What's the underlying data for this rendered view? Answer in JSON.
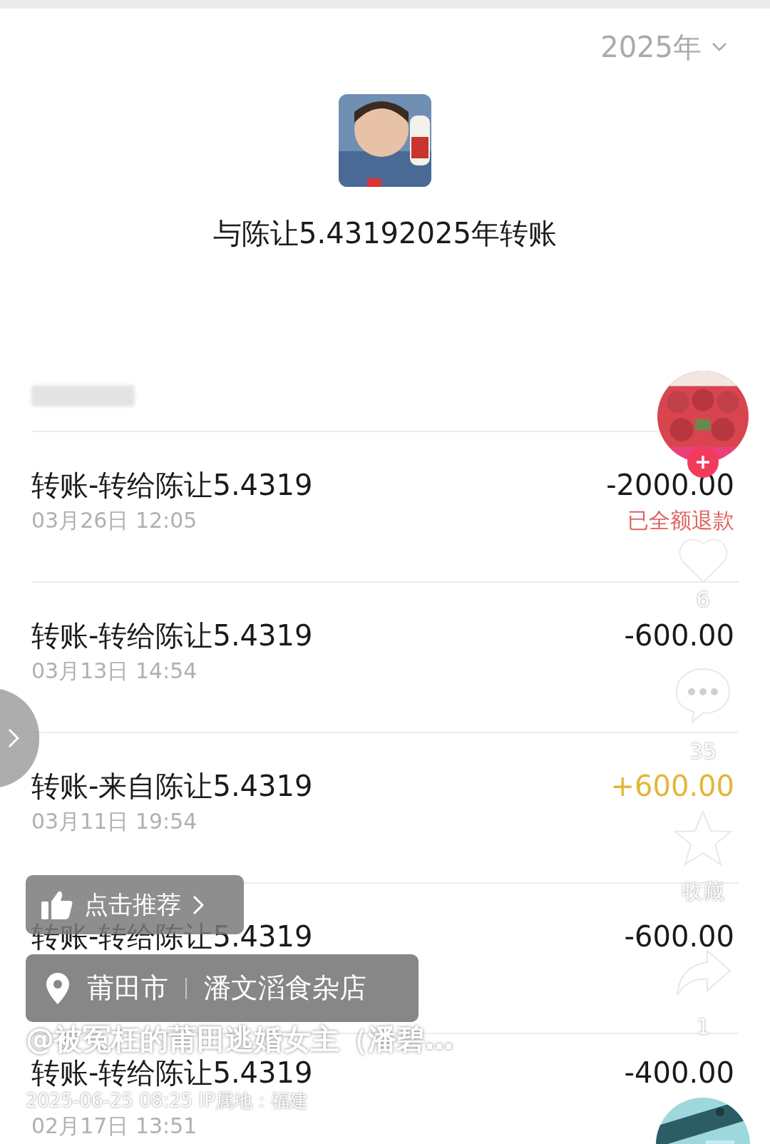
{
  "header": {
    "year": "2025年"
  },
  "title": "与陈让5.43192025年转账",
  "transactions": [
    {
      "title": "转账-转给陈让5.4319",
      "date": "03月26日 12:05",
      "amount": "-2000.00",
      "color": "#1a1a1a",
      "note": "已全额退款"
    },
    {
      "title": "转账-转给陈让5.4319",
      "date": "03月13日 14:54",
      "amount": "-600.00",
      "color": "#1a1a1a"
    },
    {
      "title": "转账-来自陈让5.4319",
      "date": "03月11日 19:54",
      "amount": "+600.00",
      "color": "#e3b63c"
    },
    {
      "title": "转账-转给陈让5.4319",
      "amount": "-600.00",
      "color": "#1a1a1a"
    },
    {
      "title": "转账-转给陈让5.4319",
      "date": "02月17日 13:51",
      "amount": "-400.00",
      "color": "#1a1a1a"
    }
  ],
  "video_overlay": {
    "recommend": "点击推荐",
    "location": {
      "city": "莆田市",
      "place": "潘文滔食杂店"
    },
    "author": "@被冤枉的莆田逃婚女主（潘碧…",
    "timestamp": "2025-06-25 08:25 IP属地：福建",
    "likes": "6",
    "comments": "35",
    "favorite_label": "收藏",
    "shares": "1"
  }
}
